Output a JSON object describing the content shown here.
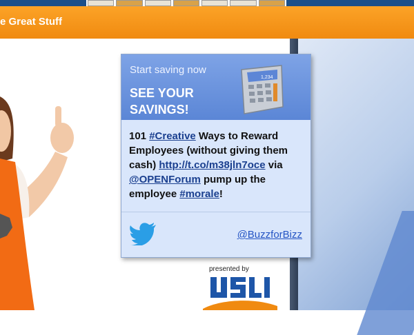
{
  "header": {
    "title": "e Great Stuff"
  },
  "widget": {
    "promo_small": "Start saving now",
    "promo_big": "SEE YOUR SAVINGS!",
    "calculator_display": "1,234",
    "tweet": {
      "prefix": "101 ",
      "hashtag1": "#Creative",
      "mid1": " Ways to Reward Employees (without giving them cash) ",
      "link": "http://t.co/m38jln7oce",
      "mid2": " via ",
      "mention": "@OPENForum",
      "mid3": " pump up the employee ",
      "hashtag2": "#morale",
      "suffix": "!"
    },
    "handle": "@BuzzforBizz"
  },
  "sponsor": {
    "presented_by": "presented by",
    "logo_text": "USLI"
  },
  "colors": {
    "header_orange": "#f7941d",
    "card_blue": "#6b93de",
    "link_blue": "#1a3f8f"
  },
  "icons": [
    "twitter-bird-icon",
    "calculator-icon"
  ]
}
